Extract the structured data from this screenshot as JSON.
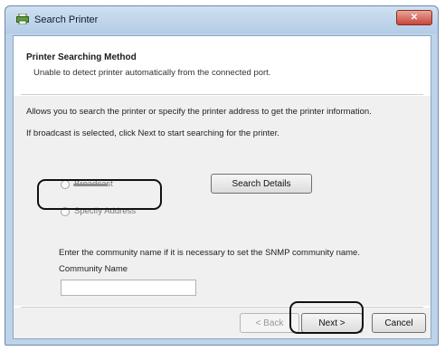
{
  "window": {
    "title": "Search Printer",
    "close_label": "✕"
  },
  "header": {
    "title": "Printer Searching Method",
    "subtitle": "Unable to detect printer automatically from the connected port."
  },
  "body": {
    "line1": "Allows you to search the printer or specify the printer address to get the printer information.",
    "line2": "If broadcast is selected, click Next to start searching for the printer.",
    "radio_broadcast": "Broadcast",
    "radio_specify": "Specify Address",
    "search_details_label": "Search Details",
    "snmp_note": "Enter the community name if it is necessary to set the SNMP community name.",
    "community_label": "Community Name",
    "community_value": ""
  },
  "footer": {
    "back_label": "< Back",
    "next_label": "Next >",
    "cancel_label": "Cancel"
  },
  "colors": {
    "frame": "#bcd3ea",
    "close": "#c8473a",
    "callout": "#111111"
  }
}
